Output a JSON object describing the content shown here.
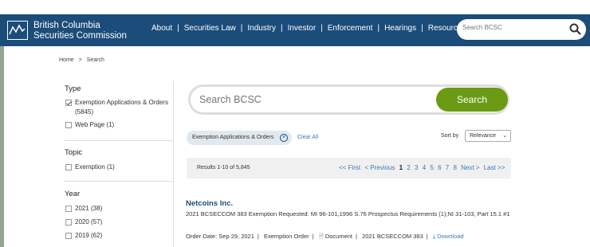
{
  "header": {
    "brand_line1": "British Columbia",
    "brand_line2": "Securities Commission",
    "nav": [
      "About",
      "Securities Law",
      "Industry",
      "Investor",
      "Enforcement",
      "Hearings",
      "Resources"
    ],
    "search_placeholder": "Search BCSC"
  },
  "breadcrumb": {
    "home": "Home",
    "sep": ">",
    "current": "Search"
  },
  "sidebar": {
    "type_heading": "Type",
    "type_items": [
      {
        "label": "Exemption Applications & Orders",
        "count": "(5845)",
        "checked": true
      },
      {
        "label": "Web Page (1)",
        "checked": false
      }
    ],
    "topic_heading": "Topic",
    "topic_items": [
      {
        "label": "Exemption (1)",
        "checked": false
      }
    ],
    "year_heading": "Year",
    "year_items": [
      {
        "label": "2021 (38)"
      },
      {
        "label": "2020 (57)"
      },
      {
        "label": "2019 (62)"
      }
    ]
  },
  "main": {
    "search_placeholder": "Search BCSC",
    "search_button": "Search",
    "chip_label": "Exemption Applications & Orders",
    "clear_all": "Clear All",
    "sort_label": "Sort by",
    "sort_value": "Relevance",
    "results_count": "Results 1-10 of 5,845",
    "pager": {
      "first": "<< First",
      "previous": "< Previous",
      "pages": [
        "1",
        "2",
        "3",
        "4",
        "5",
        "6",
        "7",
        "8"
      ],
      "next": "Next >",
      "last": "Last >>"
    },
    "result": {
      "title": "Netcoins Inc.",
      "description": "2021 BCSECCOM 383 Exemption Requested: MI 96-101,1996 S.76 Prospectus Requirements (1);NI 31-103, Part 15.1 #1",
      "order_date": "Order Date: Sep 29, 2021",
      "order_type": "Exemption Order",
      "doc_label": "Document",
      "citation": "2021 BCSECCOM 383",
      "download": "Download"
    }
  },
  "colors": {
    "header_bg": "#1b4c7a",
    "search_button": "#6b9a14",
    "link": "#3a7ab5"
  }
}
